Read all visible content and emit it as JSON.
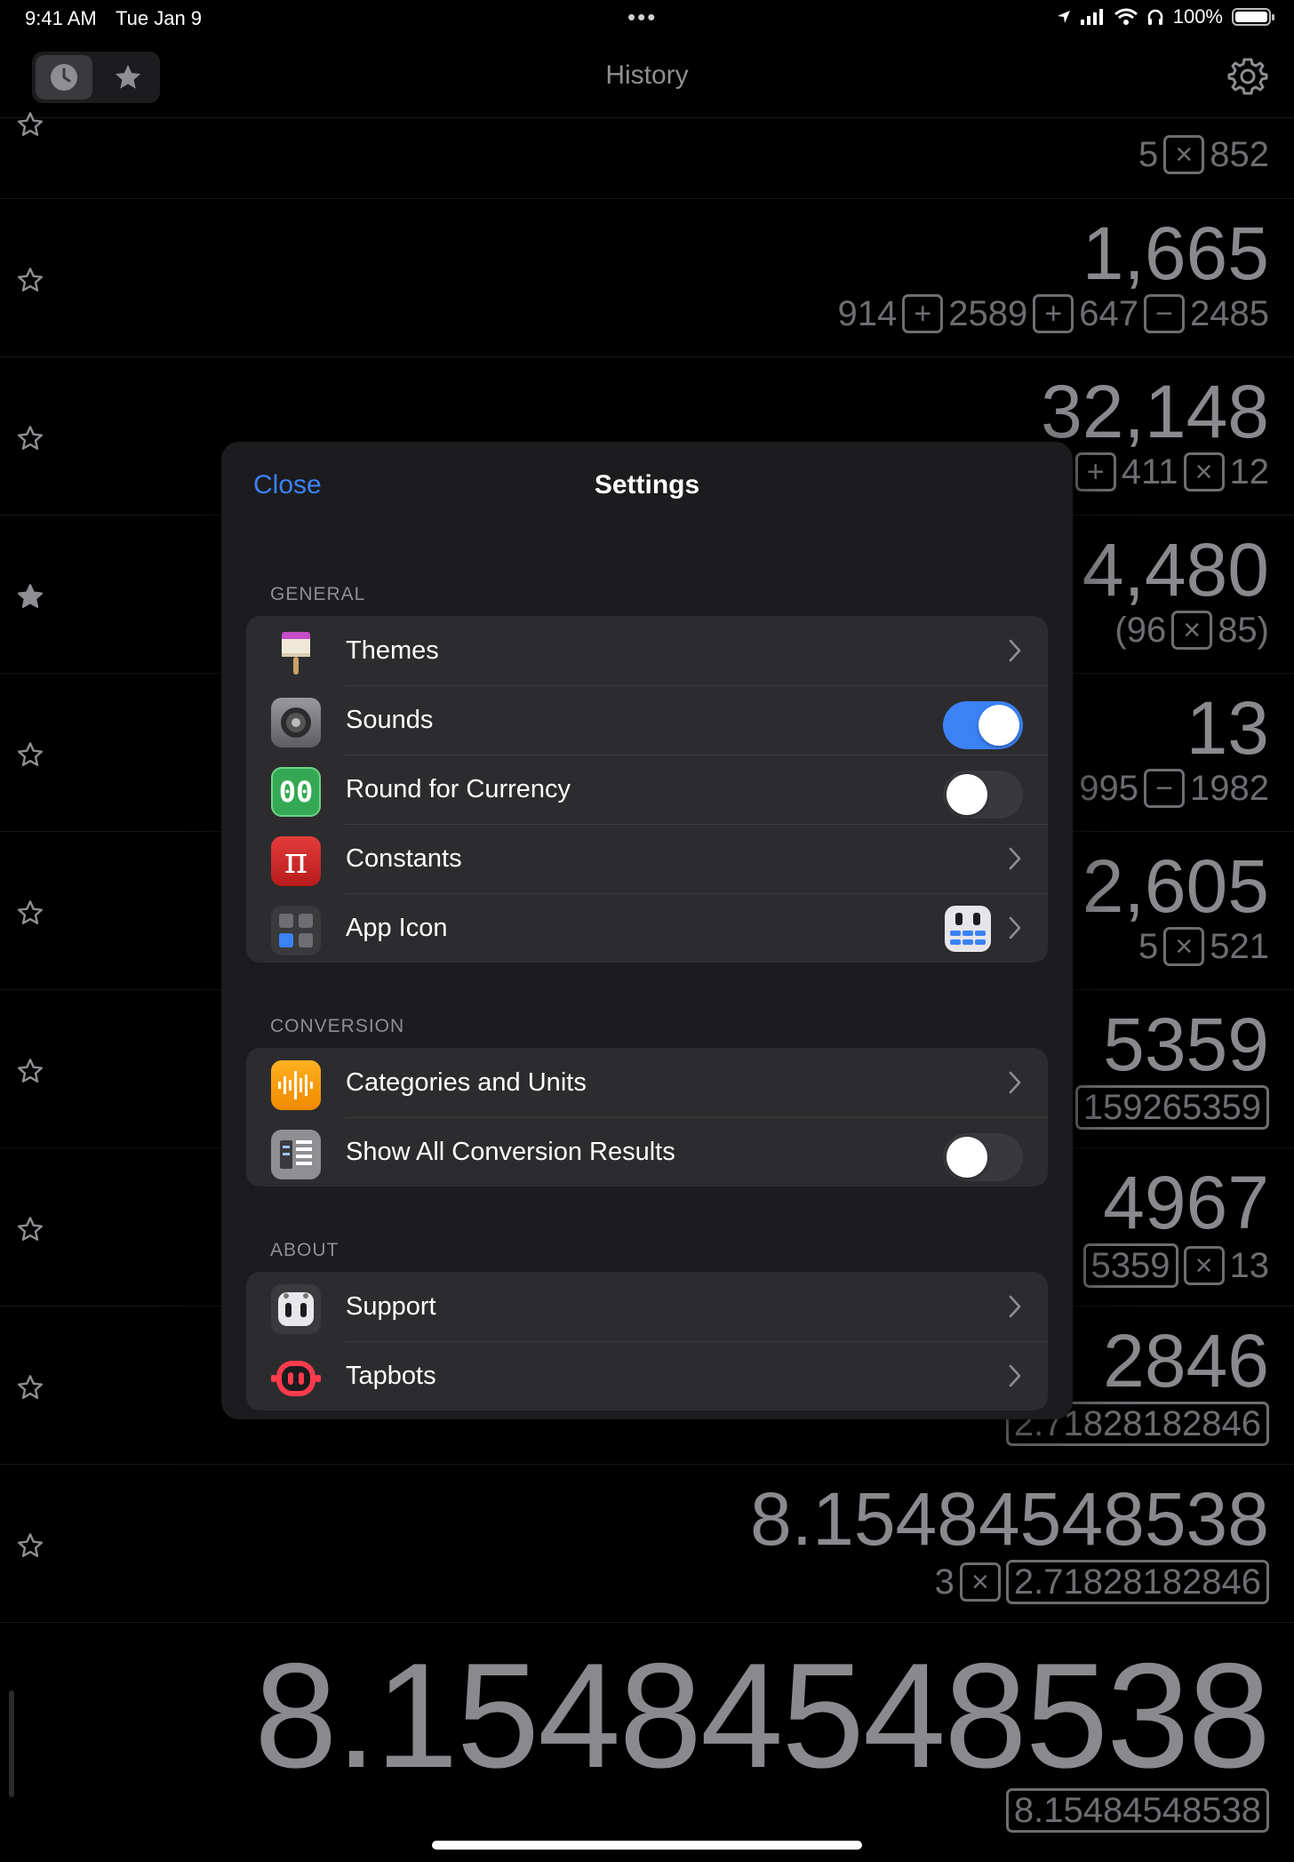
{
  "status_bar": {
    "time": "9:41 AM",
    "date": "Tue Jan 9",
    "battery": "100%"
  },
  "nav": {
    "title": "History"
  },
  "history": [
    {
      "result": "",
      "expr": [
        [
          "n",
          "5"
        ],
        [
          "op",
          "×"
        ],
        [
          "n",
          "852"
        ]
      ]
    },
    {
      "result": "1,665",
      "expr": [
        [
          "n",
          "914"
        ],
        [
          "op",
          "+"
        ],
        [
          "n",
          "2589"
        ],
        [
          "op",
          "+"
        ],
        [
          "n",
          "647"
        ],
        [
          "op",
          "−"
        ],
        [
          "n",
          "2485"
        ]
      ]
    },
    {
      "result": "32,148",
      "expr": [
        [
          "op",
          "+"
        ],
        [
          "n",
          "411"
        ],
        [
          "op",
          "×"
        ],
        [
          "n",
          "12"
        ]
      ]
    },
    {
      "result": "4,480",
      "expr": [
        [
          "n",
          "(96"
        ],
        [
          "op",
          "×"
        ],
        [
          "n",
          "85)"
        ]
      ]
    },
    {
      "result": "13",
      "expr": [
        [
          "n",
          "995"
        ],
        [
          "op",
          "−"
        ],
        [
          "n",
          "1982"
        ]
      ]
    },
    {
      "result": "2,605",
      "expr": [
        [
          "n",
          "5"
        ],
        [
          "op",
          "×"
        ],
        [
          "n",
          "521"
        ]
      ]
    },
    {
      "result": "5359",
      "expr": [
        [
          "box",
          "159265359"
        ]
      ]
    },
    {
      "result": "4967",
      "expr": [
        [
          "box",
          "5359"
        ],
        [
          "op",
          "×"
        ],
        [
          "n",
          "13"
        ]
      ]
    },
    {
      "result": "2846",
      "expr": [
        [
          "box",
          "2.71828182846"
        ]
      ]
    },
    {
      "result": "8.15484548538",
      "expr": [
        [
          "n",
          "3"
        ],
        [
          "op",
          "×"
        ],
        [
          "box",
          "2.71828182846"
        ]
      ]
    }
  ],
  "current": {
    "result": "8.15484548538",
    "expr": "8.15484548538"
  },
  "settings": {
    "close": "Close",
    "title": "Settings",
    "general_label": "GENERAL",
    "conversion_label": "CONVERSION",
    "about_label": "ABOUT",
    "general": [
      {
        "label": "Themes",
        "icon": "paint-brush-icon",
        "control": "chevron"
      },
      {
        "label": "Sounds",
        "icon": "speaker-icon",
        "control": "toggle-on"
      },
      {
        "label": "Round for Currency",
        "icon": "currency-00-icon",
        "control": "toggle-off"
      },
      {
        "label": "Constants",
        "icon": "pi-icon",
        "control": "chevron"
      },
      {
        "label": "App Icon",
        "icon": "grid-icon",
        "control": "chevron"
      }
    ],
    "conversion": [
      {
        "label": "Categories and Units",
        "icon": "waveform-icon",
        "control": "chevron"
      },
      {
        "label": "Show All Conversion Results",
        "icon": "list-icon",
        "control": "toggle-off"
      }
    ],
    "about": [
      {
        "label": "Support",
        "icon": "robot-icon",
        "control": "chevron"
      },
      {
        "label": "Tapbots",
        "icon": "tapbots-icon",
        "control": "chevron"
      }
    ],
    "icon_text": {
      "currency": "00",
      "pi": "π"
    },
    "accent": "#3b82f6"
  }
}
